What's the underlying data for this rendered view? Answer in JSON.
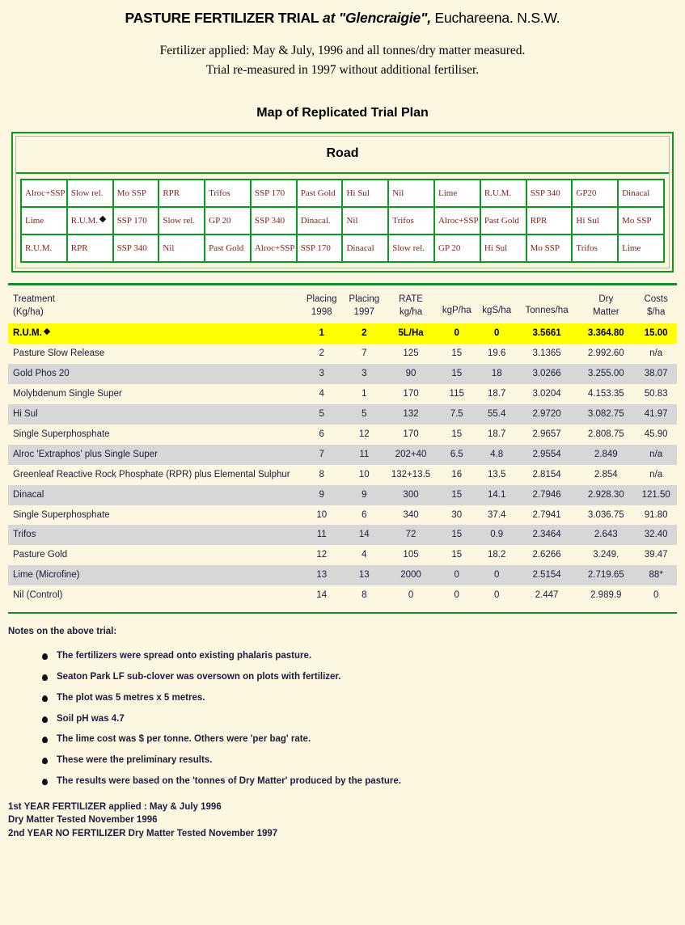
{
  "header": {
    "title_bold": "PASTURE FERTILIZER TRIAL",
    "title_italic": " at \"Glencraigie\",",
    "title_rest": " Euchareena. N.S.W.",
    "subtitle_line1": "Fertilizer applied: May & July, 1996 and all tonnes/dry matter measured.",
    "subtitle_line2": "Trial re-measured in 1997 without additional fertiliser."
  },
  "map": {
    "caption": "Map of Replicated Trial Plan",
    "road_label": "Road",
    "rows": [
      [
        "Alroc+SSP",
        "Slow rel.",
        "Mo SSP",
        "RPR",
        "Trifos",
        "SSP 170",
        "Past Gold",
        "Hi Sul",
        "Nil",
        "Lime",
        "R.U.M.",
        "SSP 340",
        "GP20",
        "Dinacal"
      ],
      [
        "Lime",
        "R.U.M.",
        "SSP 170",
        "Slow rel.",
        "GP 20",
        "SSP 340",
        "Dinacal.",
        "Nil",
        "Trifos",
        "Alroc+SSP",
        "Past Gold",
        "RPR",
        "Hi Sul",
        "Mo SSP"
      ],
      [
        "R.U.M.",
        "RPR",
        "SSP 340",
        "Nil",
        "Past Gold",
        "Alroc+SSP",
        "SSP 170",
        "Dinacal",
        "Slow rel.",
        "GP 20",
        "Hi Sul",
        "Mo SSP",
        "Trifos",
        "Lime"
      ]
    ],
    "marked_cell": {
      "row": 1,
      "col": 1,
      "marker": "diamond-marker"
    }
  },
  "table": {
    "headers": {
      "treatment_l1": "Treatment",
      "treatment_l2": "(Kg/ha)",
      "placing1998_l1": "Placing",
      "placing1998_l2": "1998",
      "placing1997_l1": "Placing",
      "placing1997_l2": "1997",
      "rate_l1": "RATE",
      "rate_l2": "kg/ha",
      "kgp": "kgP/ha",
      "kgs": "kgS/ha",
      "tonnes": "Tonnes/ha",
      "dm_l1": "Dry",
      "dm_l2": "Matter",
      "costs_l1": "Costs",
      "costs_l2": "$/ha"
    },
    "rows": [
      {
        "treatment": "R.U.M.",
        "placing1998": "1",
        "placing1997": "2",
        "rate": "5L/Ha",
        "kgp": "0",
        "kgs": "0",
        "tonnes": "3.5661",
        "dm": "3.364.80",
        "cost": "15.00",
        "highlight": true,
        "marker": true
      },
      {
        "treatment": "Pasture Slow Release",
        "placing1998": "2",
        "placing1997": "7",
        "rate": "125",
        "kgp": "15",
        "kgs": "19.6",
        "tonnes": "3.1365",
        "dm": "2.992.60",
        "cost": "n/a",
        "highlight": false,
        "marker": false
      },
      {
        "treatment": "Gold Phos 20",
        "placing1998": "3",
        "placing1997": "3",
        "rate": "90",
        "kgp": "15",
        "kgs": "18",
        "tonnes": "3.0266",
        "dm": "3.255.00",
        "cost": "38.07",
        "highlight": false,
        "marker": false
      },
      {
        "treatment": "Molybdenum Single Super",
        "placing1998": "4",
        "placing1997": "1",
        "rate": "170",
        "kgp": "115",
        "kgs": "18.7",
        "tonnes": "3.0204",
        "dm": "4.153.35",
        "cost": "50.83",
        "highlight": false,
        "marker": false
      },
      {
        "treatment": "Hi Sul",
        "placing1998": "5",
        "placing1997": "5",
        "rate": "132",
        "kgp": "7.5",
        "kgs": "55.4",
        "tonnes": "2.9720",
        "dm": "3.082.75",
        "cost": "41.97",
        "highlight": false,
        "marker": false
      },
      {
        "treatment": "Single Superphosphate",
        "placing1998": "6",
        "placing1997": "12",
        "rate": "170",
        "kgp": "15",
        "kgs": "18.7",
        "tonnes": "2.9657",
        "dm": "2.808.75",
        "cost": "45.90",
        "highlight": false,
        "marker": false
      },
      {
        "treatment": "Alroc 'Extraphos' plus Single Super",
        "placing1998": "7",
        "placing1997": "11",
        "rate": "202+40",
        "kgp": "6.5",
        "kgs": "4.8",
        "tonnes": "2.9554",
        "dm": "2.849",
        "cost": "n/a",
        "highlight": false,
        "marker": false
      },
      {
        "treatment": "Greenleaf Reactive Rock Phosphate (RPR) plus Elemental Sulphur",
        "placing1998": "8",
        "placing1997": "10",
        "rate": "132+13.5",
        "kgp": "16",
        "kgs": "13.5",
        "tonnes": "2.8154",
        "dm": "2.854",
        "cost": "n/a",
        "highlight": false,
        "marker": false
      },
      {
        "treatment": "Dinacal",
        "placing1998": "9",
        "placing1997": "9",
        "rate": "300",
        "kgp": "15",
        "kgs": "14.1",
        "tonnes": "2.7946",
        "dm": "2.928.30",
        "cost": "121.50",
        "highlight": false,
        "marker": false
      },
      {
        "treatment": "Single Superphosphate",
        "placing1998": "10",
        "placing1997": "6",
        "rate": "340",
        "kgp": "30",
        "kgs": "37.4",
        "tonnes": "2.7941",
        "dm": "3.036.75",
        "cost": "91.80",
        "highlight": false,
        "marker": false
      },
      {
        "treatment": "Trifos",
        "placing1998": "11",
        "placing1997": "14",
        "rate": "72",
        "kgp": "15",
        "kgs": "0.9",
        "tonnes": "2.3464",
        "dm": "2.643",
        "cost": "32.40",
        "highlight": false,
        "marker": false
      },
      {
        "treatment": "Pasture Gold",
        "placing1998": "12",
        "placing1997": "4",
        "rate": "105",
        "kgp": "15",
        "kgs": "18.2",
        "tonnes": "2.6266",
        "dm": "3.249.",
        "cost": "39.47",
        "highlight": false,
        "marker": false
      },
      {
        "treatment": "Lime (Microfine)",
        "placing1998": "13",
        "placing1997": "13",
        "rate": "2000",
        "kgp": "0",
        "kgs": "0",
        "tonnes": "2.5154",
        "dm": "2.719.65",
        "cost": "88*",
        "highlight": false,
        "marker": false
      },
      {
        "treatment": "Nil (Control)",
        "placing1998": "14",
        "placing1997": "8",
        "rate": "0",
        "kgp": "0",
        "kgs": "0",
        "tonnes": "2.447",
        "dm": "2.989.9",
        "cost": "0",
        "highlight": false,
        "marker": false
      }
    ]
  },
  "notes": {
    "heading": "Notes on the above trial:",
    "items": [
      "The fertilizers were spread onto existing phalaris pasture.",
      "Seaton Park LF sub-clover was oversown on plots with fertilizer.",
      "The plot was 5 metres x 5 metres.",
      "Soil pH was 4.7",
      "The lime cost was $ per tonne. Others were 'per bag' rate.",
      "These were the preliminary results.",
      "The results were based on the 'tonnes of Dry Matter' produced by the pasture."
    ]
  },
  "footer": {
    "line1": "1st YEAR FERTILIZER applied : May & July 1996",
    "line2": "Dry Matter Tested November 1996",
    "line3": "2nd YEAR NO FERTILIZER Dry Matter Tested November 1997"
  },
  "colors": {
    "page_background": "#fdf6e0",
    "grid_green": "#0a9a22",
    "rule_green": "#1a8a28",
    "plot_text": "#8b1a1a",
    "highlight_yellow": "#ffff00",
    "alt_row_gray": "#d7d7d7",
    "text": "#1c1c3c"
  }
}
